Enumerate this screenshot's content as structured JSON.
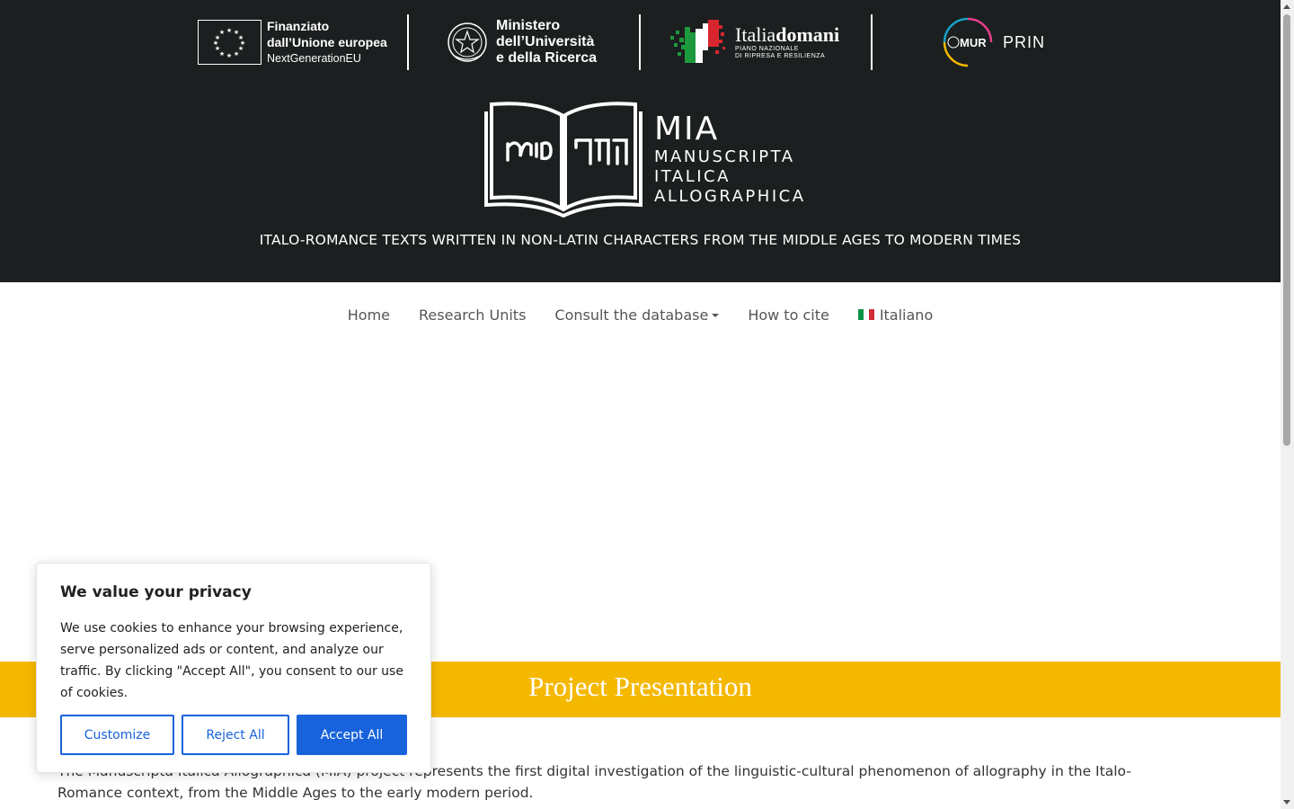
{
  "sponsors": {
    "eu": {
      "line1": "Finanziato",
      "line2": "dall’Unione europea",
      "line3": "NextGenerationEU"
    },
    "ministry": {
      "line1": "Ministero",
      "line2": "dell’Università",
      "line3": "e della Ricerca"
    },
    "italiadomani": {
      "part1": "Italia",
      "part2": "domani",
      "line2": "PIANO NAZIONALE",
      "line3": "DI RIPRESA E RESILIENZA"
    },
    "prin": {
      "mur": "MUR",
      "label": "PRIN"
    }
  },
  "logo": {
    "title": "MIA",
    "sub1": "MANUSCRIPTA",
    "sub2": "ITALICA",
    "sub3": "ALLOGRAPHICA"
  },
  "tagline": "ITALO-ROMANCE TEXTS WRITTEN IN NON-LATIN CHARACTERS FROM THE MIDDLE AGES TO MODERN TIMES",
  "nav": {
    "home": "Home",
    "research_units": "Research Units",
    "consult_db": "Consult the database",
    "how_to_cite": "How to cite",
    "language": "Italiano"
  },
  "section": {
    "title": "Project Presentation"
  },
  "intro": "The Manuscripta Italica Allographica (MIA) project represents the first digital investigation of the linguistic-cultural phenomenon of allography in the Italo-Romance context, from the Middle Ages to the early modern period.",
  "cookie": {
    "title": "We value your privacy",
    "body": "We use cookies to enhance your browsing experience, serve personalized ads or content, and analyze our traffic. By clicking \"Accept All\", you consent to our use of cookies.",
    "customize": "Customize",
    "reject": "Reject All",
    "accept": "Accept All"
  },
  "colors": {
    "header_bg": "#1c1f20",
    "accent_yellow": "#f5b800",
    "cookie_blue": "#1863dc"
  }
}
